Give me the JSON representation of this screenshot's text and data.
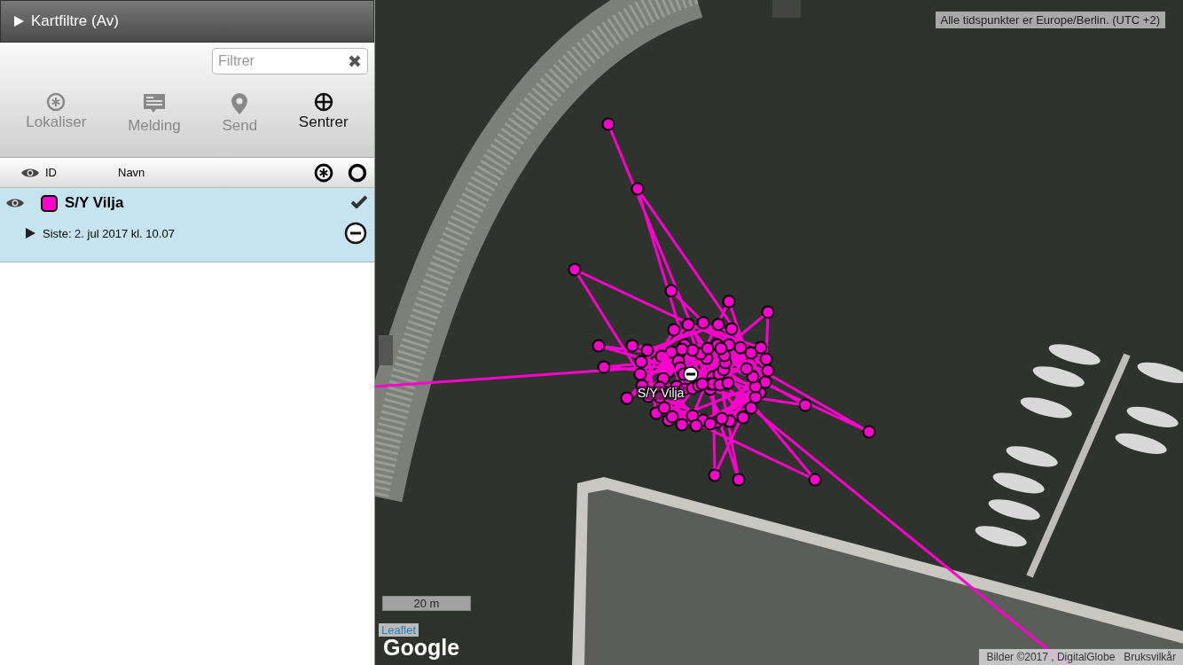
{
  "panel_header": {
    "title": "Kartfiltre (Av)",
    "expanded": false
  },
  "filter": {
    "placeholder": "Filtrer"
  },
  "toolbar": [
    {
      "label": "Lokaliser",
      "kind": "locate",
      "disabled": true
    },
    {
      "label": "Melding",
      "kind": "message",
      "disabled": true
    },
    {
      "label": "Send",
      "kind": "send",
      "disabled": true
    },
    {
      "label": "Sentrer",
      "kind": "center",
      "disabled": false
    }
  ],
  "list_header": {
    "columns": [
      "ID",
      "Navn"
    ]
  },
  "vessels": [
    {
      "name": "S/Y Vilja",
      "color": "#ff00cc",
      "selected": true,
      "checked": true,
      "expanded": false,
      "last_seen": "Siste: 2. jul 2017 kl. 10.07"
    }
  ],
  "map": {
    "timezone_note": "Alle tidspunkter er Europe/Berlin. (UTC +2)",
    "marker_label": "S/Y Vilja",
    "scale": "20 m",
    "leaflet_link": "Leaflet",
    "logo": "Google",
    "attribution": "Bilder ©2017 , DigitalGlobe",
    "terms_link": "Bruksvilkår"
  }
}
